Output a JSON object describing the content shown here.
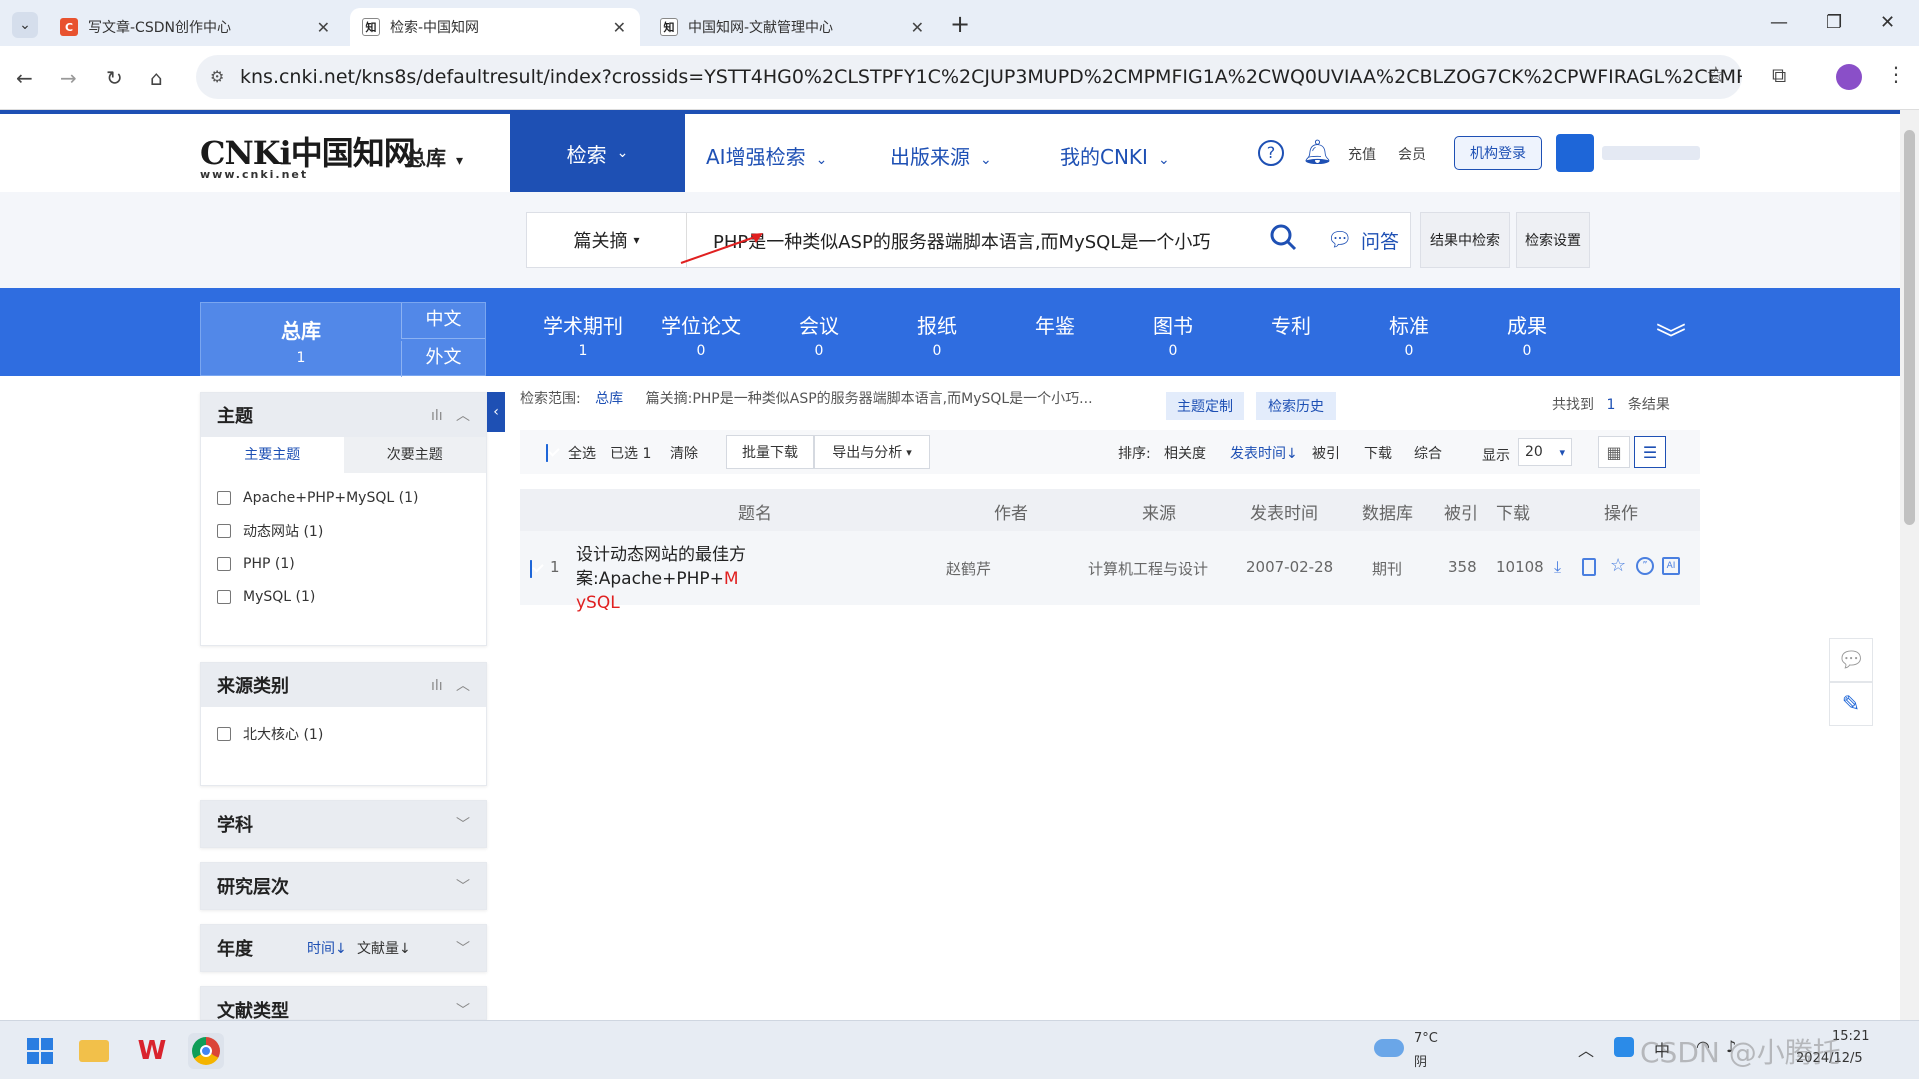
{
  "browser": {
    "tabs": [
      {
        "title": "写文章-CSDN创作中心",
        "favicon": "C"
      },
      {
        "title": "检索-中国知网",
        "favicon": "知"
      },
      {
        "title": "中国知网-文献管理中心",
        "favicon": "知"
      }
    ],
    "url": "kns.cnki.net/kns8s/defaultresult/index?crossids=YSTT4HG0%2CLSTPFY1C%2CJUP3MUPD%2CMPMFIG1A%2CWQ0UVIAA%2CBLZOG7CK%2CPWFIRAGL%2CEMRPGLPA%2C..."
  },
  "header": {
    "logo_text": "CNKi中国知网",
    "logo_sub": "www.cnki.net",
    "db_select": "总库",
    "nav": [
      "检索",
      "AI增强检索",
      "出版来源",
      "我的CNKI"
    ],
    "recharge": "充值",
    "member": "会员",
    "inst_login": "机构登录"
  },
  "search": {
    "field": "篇关摘",
    "query": "PHP是一种类似ASP的服务器端脚本语言,而MySQL是一个小巧",
    "qa": "问答",
    "in_results": "结果中检索",
    "settings": "检索设置"
  },
  "categories": {
    "zongku": {
      "name": "总库",
      "count": "1",
      "zh": "中文",
      "wai": "外文"
    },
    "items": [
      {
        "name": "学术期刊",
        "count": "1"
      },
      {
        "name": "学位论文",
        "count": "0"
      },
      {
        "name": "会议",
        "count": "0"
      },
      {
        "name": "报纸",
        "count": "0"
      },
      {
        "name": "年鉴",
        "count": ""
      },
      {
        "name": "图书",
        "count": "0"
      },
      {
        "name": "专利",
        "count": ""
      },
      {
        "name": "标准",
        "count": "0"
      },
      {
        "name": "成果",
        "count": "0"
      }
    ]
  },
  "sidebar": {
    "topic": {
      "title": "主题",
      "tabs": [
        "主要主题",
        "次要主题"
      ],
      "items": [
        "Apache+PHP+MySQL (1)",
        "动态网站 (1)",
        "PHP (1)",
        "MySQL (1)"
      ]
    },
    "source": {
      "title": "来源类别",
      "items": [
        "北大核心 (1)"
      ]
    },
    "subject": "学科",
    "level": "研究层次",
    "year": {
      "title": "年度",
      "sort_time": "时间",
      "sort_count": "文献量"
    },
    "doctype": "文献类型"
  },
  "results": {
    "scope_label": "检索范围:",
    "scope_db": "总库",
    "scope_query": "篇关摘:PHP是一种类似ASP的服务器端脚本语言,而MySQL是一个小巧...",
    "topic_custom": "主题定制",
    "history": "检索历史",
    "found_prefix": "共找到",
    "found_count": "1",
    "found_suffix": "条结果",
    "toolbar": {
      "select_all": "全选",
      "selected": "已选",
      "selected_count": "1",
      "clear": "清除",
      "batch_download": "批量下载",
      "export": "导出与分析",
      "sort_label": "排序:",
      "sort_relevance": "相关度",
      "sort_date": "发表时间",
      "sort_cited": "被引",
      "sort_download": "下载",
      "sort_overall": "综合",
      "display": "显示",
      "page_size": "20"
    },
    "columns": [
      "题名",
      "作者",
      "来源",
      "发表时间",
      "数据库",
      "被引",
      "下载",
      "操作"
    ],
    "rows": [
      {
        "index": "1",
        "title_main": "设计动态网站的最佳方案:Apache+PHP+",
        "title_hl1": "M",
        "title_hl2": "ySQL",
        "author": "赵鹤芹",
        "source": "计算机工程与设计",
        "date": "2007-02-28",
        "db": "期刊",
        "cited": "358",
        "downloads": "10108"
      }
    ]
  },
  "taskbar": {
    "temp": "7°C",
    "weather": "阴",
    "ime": "中",
    "date": "2024/12/5",
    "time": "15:21",
    "watermark": "CSDN @小腾托"
  },
  "colors": {
    "brand": "#1e50b4",
    "band": "#2f6de0",
    "highlight": "#e02020"
  }
}
